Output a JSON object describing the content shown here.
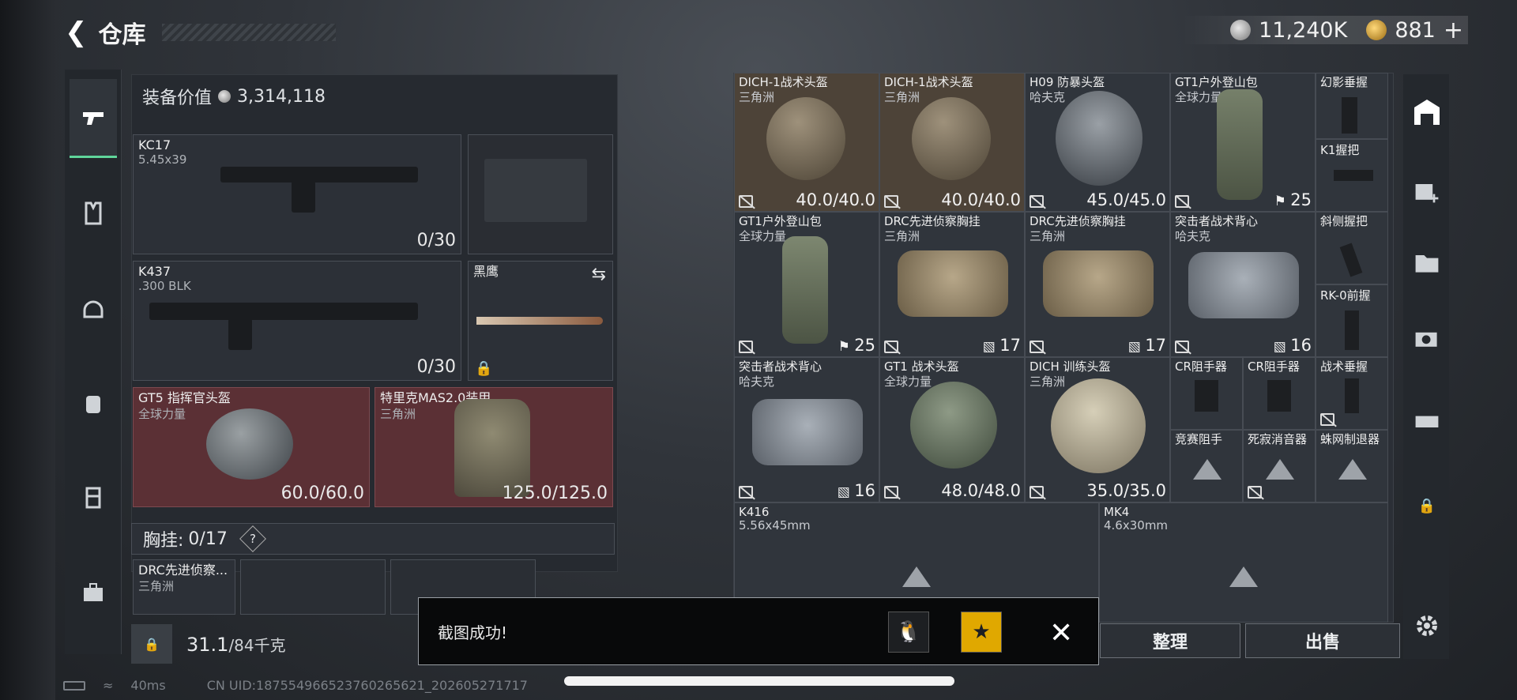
{
  "header": {
    "title": "仓库",
    "silver": "11,240K",
    "gold": "881",
    "plus": "+"
  },
  "loadout": {
    "value_label": "装备价值",
    "value": "3,314,118",
    "primary": {
      "name": "KC17",
      "ammo": "5.45x39",
      "count": "0/30"
    },
    "secondary": {
      "name": "K437",
      "ammo": ".300 BLK",
      "count": "0/30"
    },
    "melee": {
      "name": "黑鹰"
    },
    "helmet": {
      "name": "GT5 指挥官头盔",
      "brand": "全球力量",
      "durability": "60.0/60.0"
    },
    "armor": {
      "name": "特里克MAS2.0装甲",
      "brand": "三角洲",
      "durability": "125.0/125.0"
    },
    "chest_label": "胸挂:",
    "chest_count": "0/17",
    "chest_help": "?",
    "chest_item": {
      "name": "DRC先进侦察...",
      "brand": "三角洲"
    },
    "weight_value": "31.1",
    "weight_max": "/84千克"
  },
  "grid": {
    "row1": [
      {
        "name": "DICH-1战术头盔",
        "brand": "三角洲",
        "dur": "40.0/40.0"
      },
      {
        "name": "DICH-1战术头盔",
        "brand": "三角洲",
        "dur": "40.0/40.0"
      },
      {
        "name": "H09 防暴头盔",
        "brand": "哈夫克",
        "dur": "45.0/45.0"
      },
      {
        "name": "GT1户外登山包",
        "brand": "全球力量",
        "dur": "25"
      },
      {
        "name": "幻影垂握",
        "brand": ""
      }
    ],
    "k1": "K1握把",
    "row2": [
      {
        "name": "GT1户外登山包",
        "brand": "全球力量",
        "dur": "25"
      },
      {
        "name": "DRC先进侦察胸挂",
        "brand": "三角洲",
        "dur": "17"
      },
      {
        "name": "DRC先进侦察胸挂",
        "brand": "三角洲",
        "dur": "17"
      },
      {
        "name": "突击者战术背心",
        "brand": "哈夫克",
        "dur": "16"
      },
      {
        "name": "斜侧握把",
        "brand": ""
      }
    ],
    "rk0": "RK-0前握",
    "row3": [
      {
        "name": "突击者战术背心",
        "brand": "哈夫克",
        "dur": "16"
      },
      {
        "name": "GT1 战术头盔",
        "brand": "全球力量",
        "dur": "48.0/48.0"
      },
      {
        "name": "DICH 训练头盔",
        "brand": "三角洲",
        "dur": "35.0/35.0"
      },
      {
        "name": "CR阻手器",
        "brand": ""
      },
      {
        "name": "CR阻手器",
        "brand": ""
      },
      {
        "name": "战术垂握",
        "brand": ""
      }
    ],
    "row3b": [
      "竞赛阻手",
      "死寂消音器",
      "蛛网制退器"
    ],
    "weapons": [
      {
        "name": "K416",
        "ammo": "5.56x45mm"
      },
      {
        "name": "MK4",
        "ammo": "4.6x30mm"
      }
    ]
  },
  "buttons": {
    "sort": "整理",
    "sell": "出售"
  },
  "toast": {
    "message": "截图成功!"
  },
  "status": {
    "ping": "40ms",
    "uid": "CN UID:18755496652376026562​1_202605271717"
  }
}
